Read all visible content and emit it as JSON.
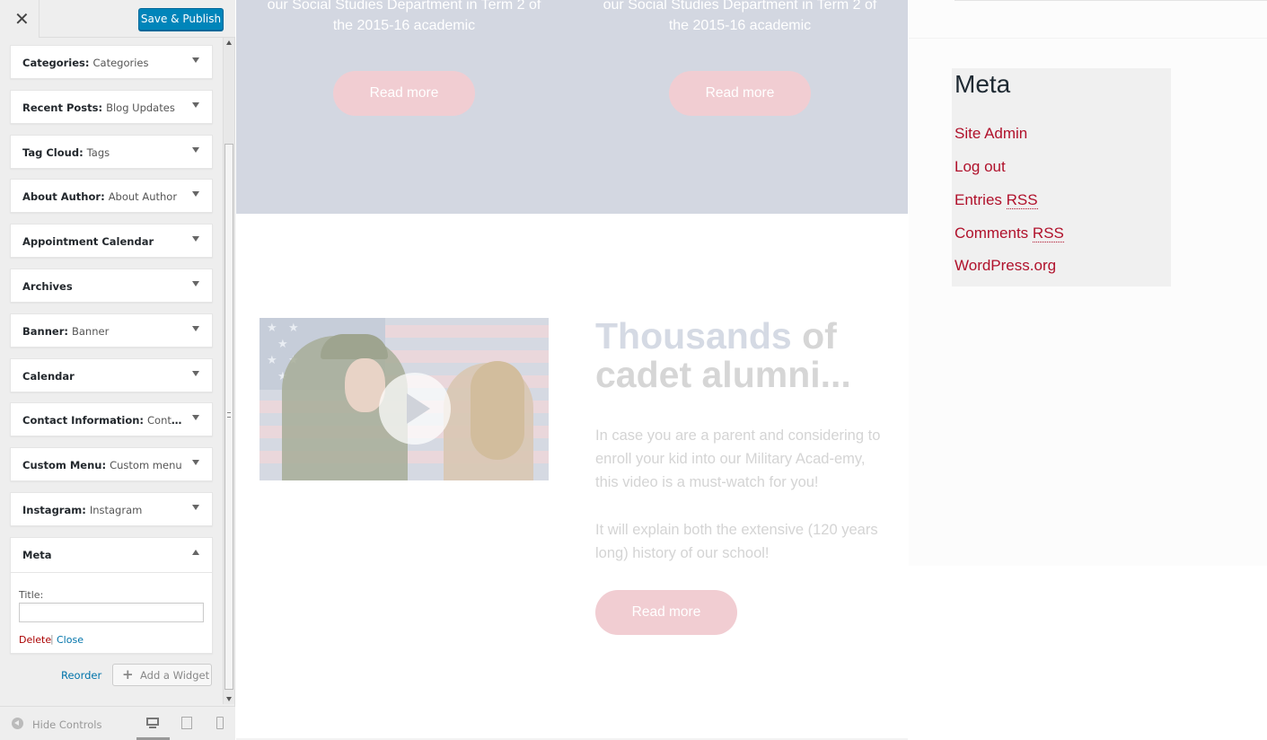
{
  "header": {
    "close_glyph": "✕",
    "publish_label": "Save & Publish"
  },
  "widgets": [
    {
      "name": "Categories",
      "sep": ": ",
      "subtitle": "Categories"
    },
    {
      "name": "Recent Posts",
      "sep": ": ",
      "subtitle": "Blog Updates"
    },
    {
      "name": "Tag Cloud",
      "sep": ": ",
      "subtitle": "Tags"
    },
    {
      "name": "About Author",
      "sep": ": ",
      "subtitle": "About Author"
    },
    {
      "name": "Appointment Calendar",
      "sep": "",
      "subtitle": ""
    },
    {
      "name": "Archives",
      "sep": "",
      "subtitle": ""
    },
    {
      "name": "Banner",
      "sep": ": ",
      "subtitle": "Banner"
    },
    {
      "name": "Calendar",
      "sep": "",
      "subtitle": ""
    },
    {
      "name": "Contact Information",
      "sep": ": ",
      "subtitle": "Contact Information"
    },
    {
      "name": "Custom Menu",
      "sep": ": ",
      "subtitle": "Custom menu"
    },
    {
      "name": "Instagram",
      "sep": ": ",
      "subtitle": "Instagram"
    }
  ],
  "meta_widget": {
    "name": "Meta",
    "title_label": "Title:",
    "title_value": "",
    "delete_label": "Delete",
    "separator": "|",
    "close_label": "Close"
  },
  "actions": {
    "reorder_label": "Reorder",
    "add_widget_icon": "+",
    "add_widget_label": "Add a Widget"
  },
  "footer": {
    "hide_controls_label": "Hide Controls",
    "devices": [
      "desktop-icon",
      "tablet-icon",
      "mobile-icon"
    ]
  },
  "preview": {
    "hero_text_1": "our Social Studies Department in Term 2 of the 2015-16 academic",
    "hero_text_2": "our Social Studies Department in Term 2 of the 2015-16 academic",
    "hero_btn_1": "Read more",
    "hero_btn_2": "Read more",
    "promo_heading_hl": "Thousands",
    "promo_heading_rest": " of cadet alumni...",
    "promo_p1": "In case you are a parent and considering to enroll your kid into our Military Acad-emy, this video is a must-watch for you!",
    "promo_p2": "It will explain both the extensive (120 years long) history of our school!",
    "promo_btn": "Read more",
    "meta_title": "Meta",
    "meta_links": {
      "site_admin": "Site Admin",
      "log_out": "Log out",
      "entries_prefix": "Entries ",
      "comments_prefix": "Comments ",
      "rss": "RSS",
      "wordpress": "WordPress.org"
    }
  },
  "colors": {
    "accent_blue": "#0085ba",
    "link_red": "#b0112b",
    "hero_bg": "#d3d7e1",
    "pill_bg": "#f1cdd2"
  }
}
